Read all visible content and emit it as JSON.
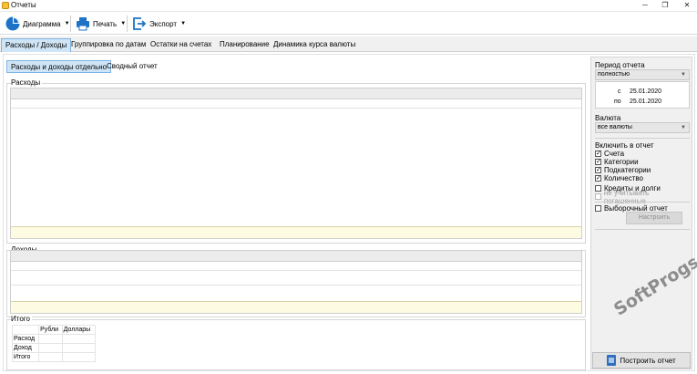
{
  "window": {
    "title": "Отчеты",
    "icon": "reports-app-icon",
    "minimize": "─",
    "maximize": "❐",
    "close": "✕"
  },
  "toolbar": {
    "chart_label": "Диаграмма",
    "print_label": "Печать",
    "export_label": "Экспорт",
    "dropdown_arrow": "▼"
  },
  "main_tabs": [
    {
      "label": "Расходы / Доходы",
      "active": true
    },
    {
      "label": "Группировка по датам",
      "active": false
    },
    {
      "label": "Остатки на счетах",
      "active": false
    },
    {
      "label": "Планирование",
      "active": false
    },
    {
      "label": "Динамика курса валюты",
      "active": false
    }
  ],
  "sub_tabs": [
    {
      "label": "Расходы и доходы отдельно",
      "active": true
    },
    {
      "label": "Сводный отчет",
      "active": false
    }
  ],
  "sections": {
    "expenses": "Расходы",
    "income": "Доходы",
    "totals": "Итого"
  },
  "totals_table": {
    "columns": [
      "",
      "Рубли",
      "Доллары"
    ],
    "rows": [
      "Расход",
      "Доход",
      "Итого"
    ]
  },
  "right_panel": {
    "period_label": "Период отчета",
    "period_value": "полностью",
    "date_from_prefix": "с",
    "date_from": "25.01.2020",
    "date_to_prefix": "по",
    "date_to": "25.01.2020",
    "currency_label": "Валюта",
    "currency_value": "все валюты",
    "include_label": "Включить в отчет",
    "include_items": [
      {
        "label": "Счета",
        "checked": true
      },
      {
        "label": "Категории",
        "checked": true
      },
      {
        "label": "Подкатегории",
        "checked": true
      },
      {
        "label": "Количество",
        "checked": true
      }
    ],
    "credits_label": "Кредиты и долги",
    "ignore_paid_label": "не учитывать погашенные",
    "selective_label": "Выборочный отчет",
    "configure_button": "Настроить",
    "build_button": "Построить отчет"
  },
  "watermark": "SoftProgs.ru",
  "colors": {
    "tab_active_bg": "#cfe5f6",
    "tab_active_border": "#7eb4e3",
    "totals_row_bg": "#fdfbe1",
    "panel_bg": "#f0f0f0",
    "chart_icon_blue": "#1e73c8"
  }
}
